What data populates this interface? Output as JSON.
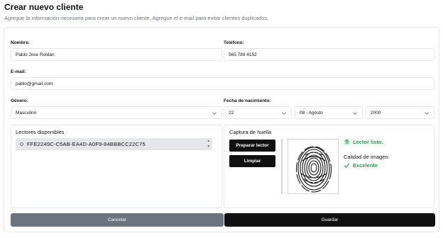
{
  "header": {
    "title": "Crear nuevo cliente",
    "subtitle": "Agregue la información necesaria para crear un nuevo cliente. Agregue el e-mail para evitar clientes duplicados."
  },
  "form": {
    "nombre_label": "Nombre:",
    "nombre_value": "Pablo Jose Roldan",
    "telefono_label": "Teléfono:",
    "telefono_value": "565 789 4152",
    "email_label": "E-mail:",
    "email_value": "pablo@gmail.com",
    "genero_label": "Género:",
    "genero_value": "Masculino",
    "fecha_label": "Fecha de nacimiento:",
    "dia_value": "22",
    "mes_value": "08 - Agosto",
    "anio_value": "2000"
  },
  "lectores": {
    "title": "Lectores disponibles",
    "items": [
      "FFE2249C-C5AB-EA4D-A0F9-84BBBCC22C75"
    ]
  },
  "captura": {
    "title": "Captura de huella",
    "prepare_label": "Preparar lector",
    "clear_label": "Limpiar",
    "status_text": "Lector listo.",
    "quality_label": "Calidad de imagen:",
    "quality_value": "Excelente"
  },
  "actions": {
    "cancel_label": "Cancelar",
    "save_label": "Guardar"
  },
  "colors": {
    "success": "#16a34a",
    "primary": "#111111",
    "secondary": "#6b7280"
  }
}
